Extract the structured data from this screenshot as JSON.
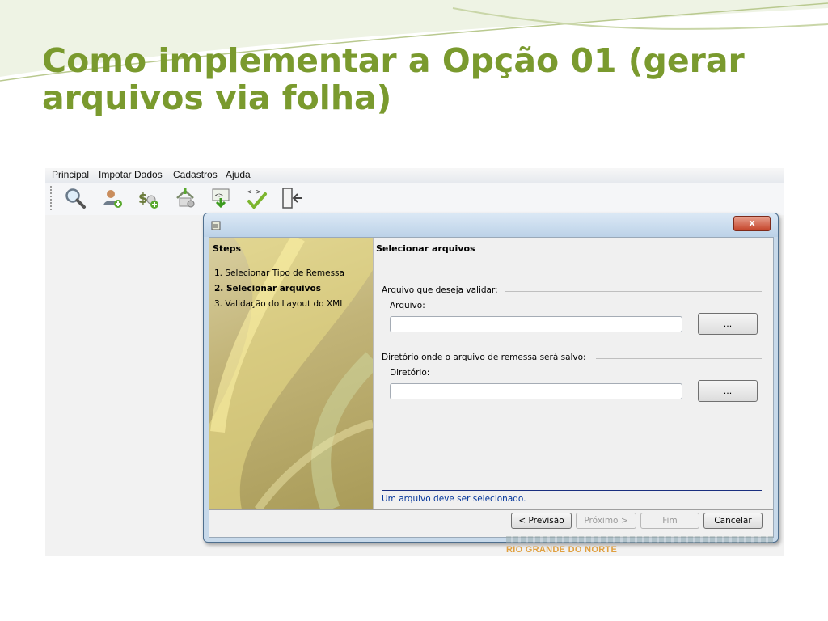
{
  "slide": {
    "title_line1": "Como implementar a Opção 01 (gerar",
    "title_line2": "arquivos via folha)",
    "title_color": "#7a9a2e"
  },
  "menu": [
    "Principal",
    "Impotar Dados",
    "Cadastros",
    "Ajuda"
  ],
  "toolbar_icons": [
    "search-icon",
    "add-person-icon",
    "add-money-icon",
    "import-home-icon",
    "export-download-icon",
    "xml-validate-icon",
    "exit-door-icon"
  ],
  "dialog": {
    "close_glyph": "x",
    "steps_title": "Steps",
    "steps": [
      "1. Selecionar Tipo de Remessa",
      "2. Selecionar arquivos",
      "3. Validação do Layout do XML"
    ],
    "current_step_index": 1,
    "content_title": "Selecionar arquivos",
    "group1": {
      "title": "Arquivo que deseja validar:",
      "label": "Arquivo:",
      "value": "",
      "button": "..."
    },
    "group2": {
      "title": "Diretório onde o arquivo de remessa será salvo:",
      "label": "Diretório:",
      "value": "",
      "button": "..."
    },
    "status": "Um arquivo deve ser selecionado.",
    "buttons": {
      "previous": "< Previsão",
      "next": "Próximo >",
      "finish": "Fim",
      "cancel": "Cancelar"
    }
  },
  "brand_text": "RIO GRANDE DO NORTE"
}
